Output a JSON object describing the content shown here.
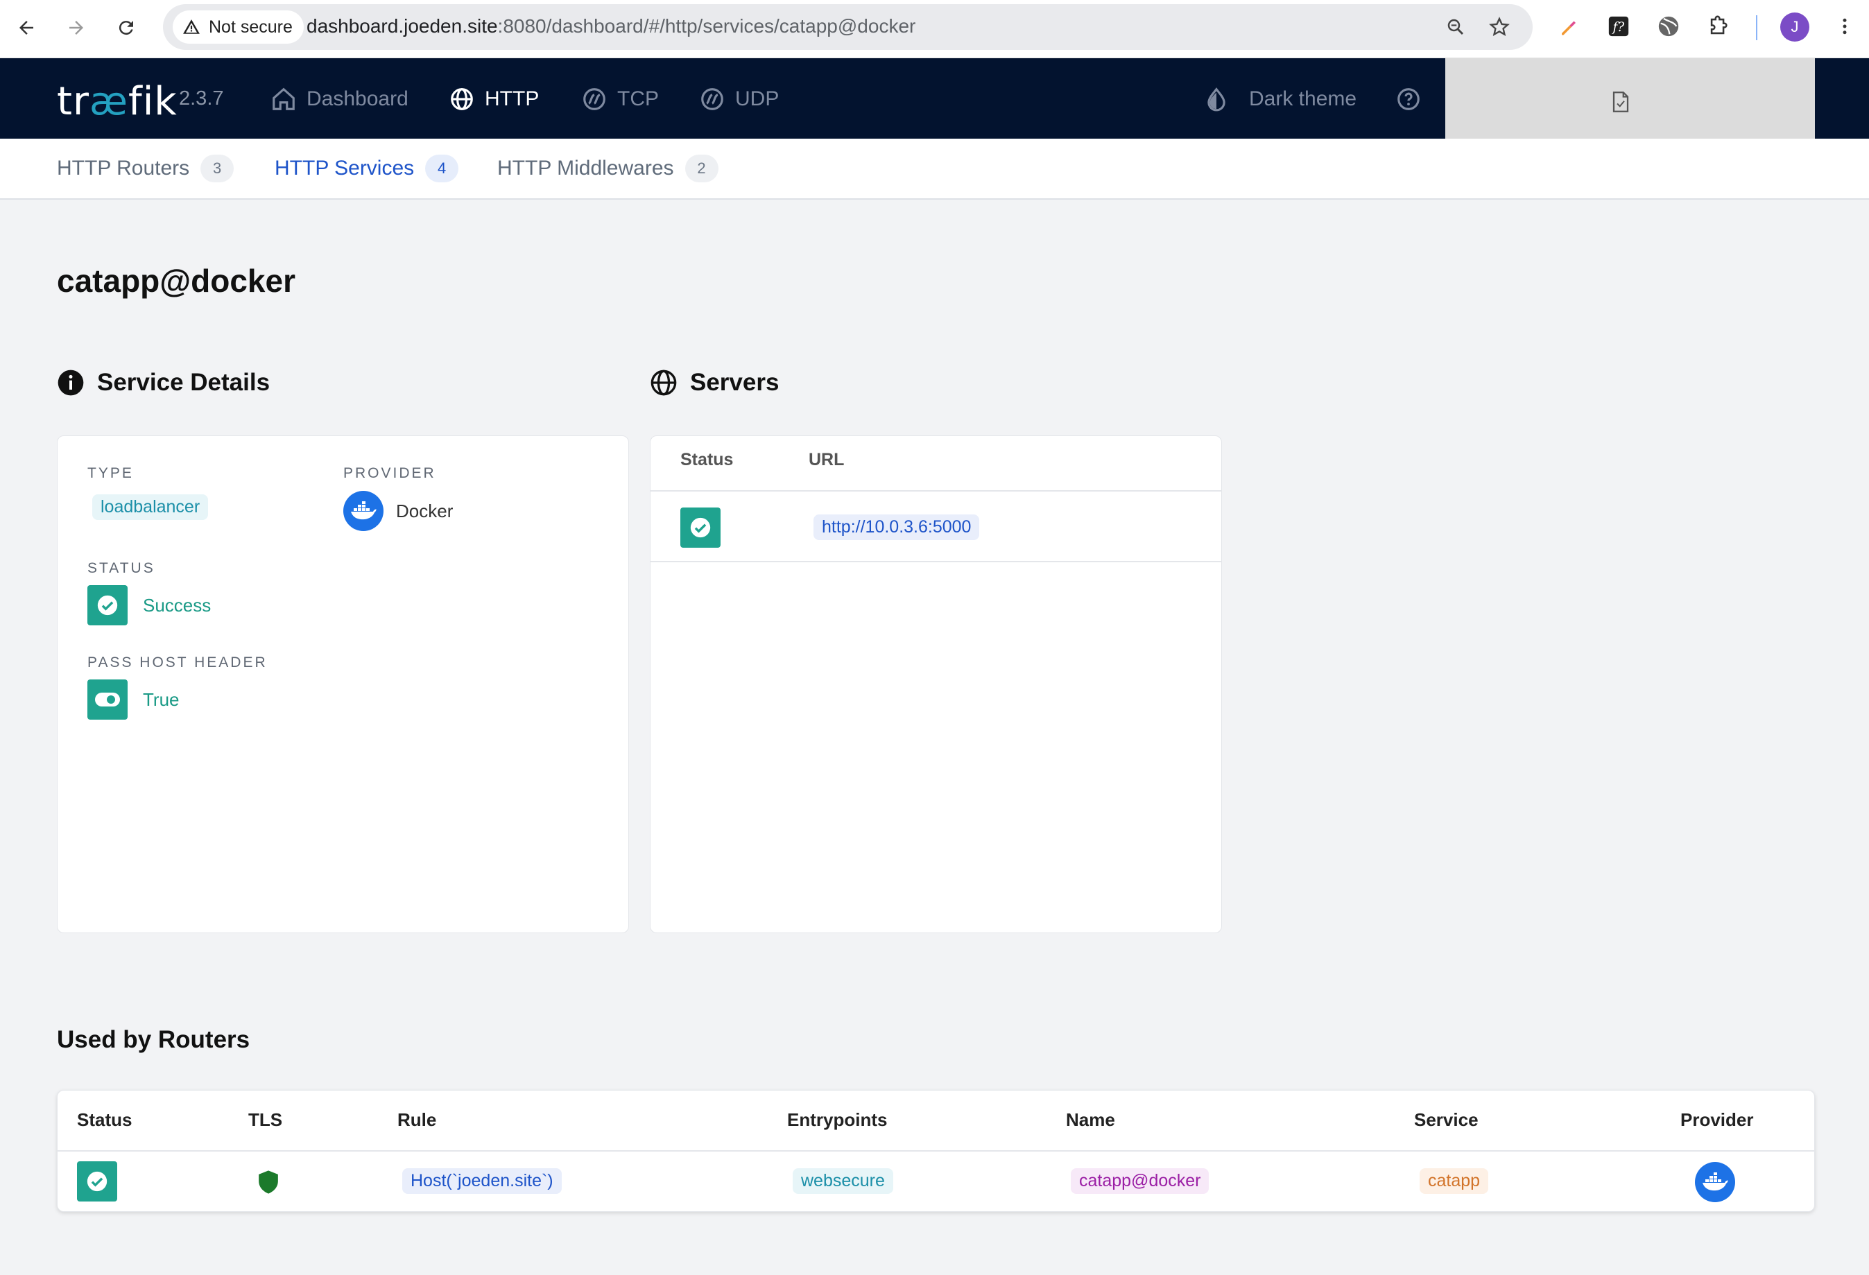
{
  "browser": {
    "security_label": "Not secure",
    "url_host": "dashboard.joeden.site",
    "url_rest": ":8080/dashboard/#/http/services/catapp@docker",
    "profile_initial": "J"
  },
  "nav": {
    "logo_pre": "tr",
    "logo_ae": "æ",
    "logo_post": "fik",
    "version": "2.3.7",
    "items": [
      {
        "label": "Dashboard",
        "icon": "home-icon"
      },
      {
        "label": "HTTP",
        "icon": "globe-icon"
      },
      {
        "label": "TCP",
        "icon": "tcp-icon"
      },
      {
        "label": "UDP",
        "icon": "udp-icon"
      }
    ],
    "dark_theme_label": "Dark theme"
  },
  "subnav": {
    "tabs": [
      {
        "label": "HTTP Routers",
        "count": "3"
      },
      {
        "label": "HTTP Services",
        "count": "4"
      },
      {
        "label": "HTTP Middlewares",
        "count": "2"
      }
    ]
  },
  "page": {
    "title": "catapp@docker"
  },
  "service_details": {
    "title": "Service Details",
    "type_label": "TYPE",
    "type_value": "loadbalancer",
    "provider_label": "PROVIDER",
    "provider_value": "Docker",
    "status_label": "STATUS",
    "status_value": "Success",
    "pass_host_label": "PASS HOST HEADER",
    "pass_host_value": "True"
  },
  "servers": {
    "title": "Servers",
    "col_status": "Status",
    "col_url": "URL",
    "rows": [
      {
        "url": "http://10.0.3.6:5000"
      }
    ]
  },
  "routers": {
    "title": "Used by Routers",
    "columns": {
      "status": "Status",
      "tls": "TLS",
      "rule": "Rule",
      "entrypoints": "Entrypoints",
      "name": "Name",
      "service": "Service",
      "provider": "Provider"
    },
    "rows": [
      {
        "rule": "Host(`joeden.site`)",
        "entrypoints": "websecure",
        "name": "catapp@docker",
        "service": "catapp"
      }
    ]
  },
  "colors": {
    "nav_bg": "#03132f",
    "accent_blue": "#1e54c9",
    "success_teal": "#1fa38f",
    "docker_blue": "#1d72e6"
  }
}
